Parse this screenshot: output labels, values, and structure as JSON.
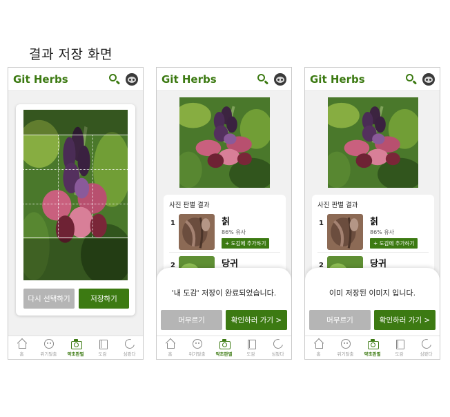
{
  "heading": "결과 저장 화면",
  "app": {
    "brand": "Git Herbs"
  },
  "tabs": [
    {
      "label": "홈",
      "icon": "home-icon"
    },
    {
      "label": "위기탈출",
      "icon": "face-icon"
    },
    {
      "label": "약초판별",
      "icon": "camera-icon"
    },
    {
      "label": "도감",
      "icon": "book-icon"
    },
    {
      "label": "심봤다",
      "icon": "pacman-icon"
    }
  ],
  "screen1": {
    "reselect_label": "다시 선택하기",
    "save_label": "저장하기"
  },
  "results": {
    "title": "사진 판별 결과",
    "items": [
      {
        "rank": "1",
        "name": "칡",
        "similarity": "86% 유사",
        "add_label": "+ 도감에 추가하기"
      },
      {
        "rank": "2",
        "name": "당귀"
      }
    ]
  },
  "screen2": {
    "message": "'내 도감' 저장이 완료되었습니다.",
    "stay_label": "머무르기",
    "go_label": "확인하러 가기 >"
  },
  "screen3": {
    "message": "이미 저장된 이미지 입니다.",
    "stay_label": "머무르기",
    "go_label": "확인하러 가기 >"
  },
  "colors": {
    "brand": "#3c7a12",
    "button_grey": "#b5b5b5"
  }
}
